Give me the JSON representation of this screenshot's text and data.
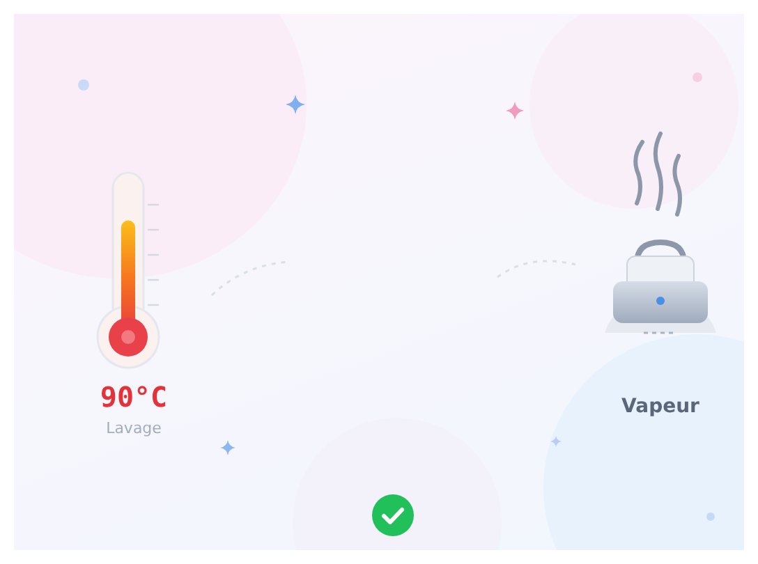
{
  "wash": {
    "temperature": "90°C",
    "label": "Lavage",
    "level": 0.85
  },
  "steam": {
    "label": "Vapeur"
  },
  "status": {
    "kind": "ok"
  }
}
